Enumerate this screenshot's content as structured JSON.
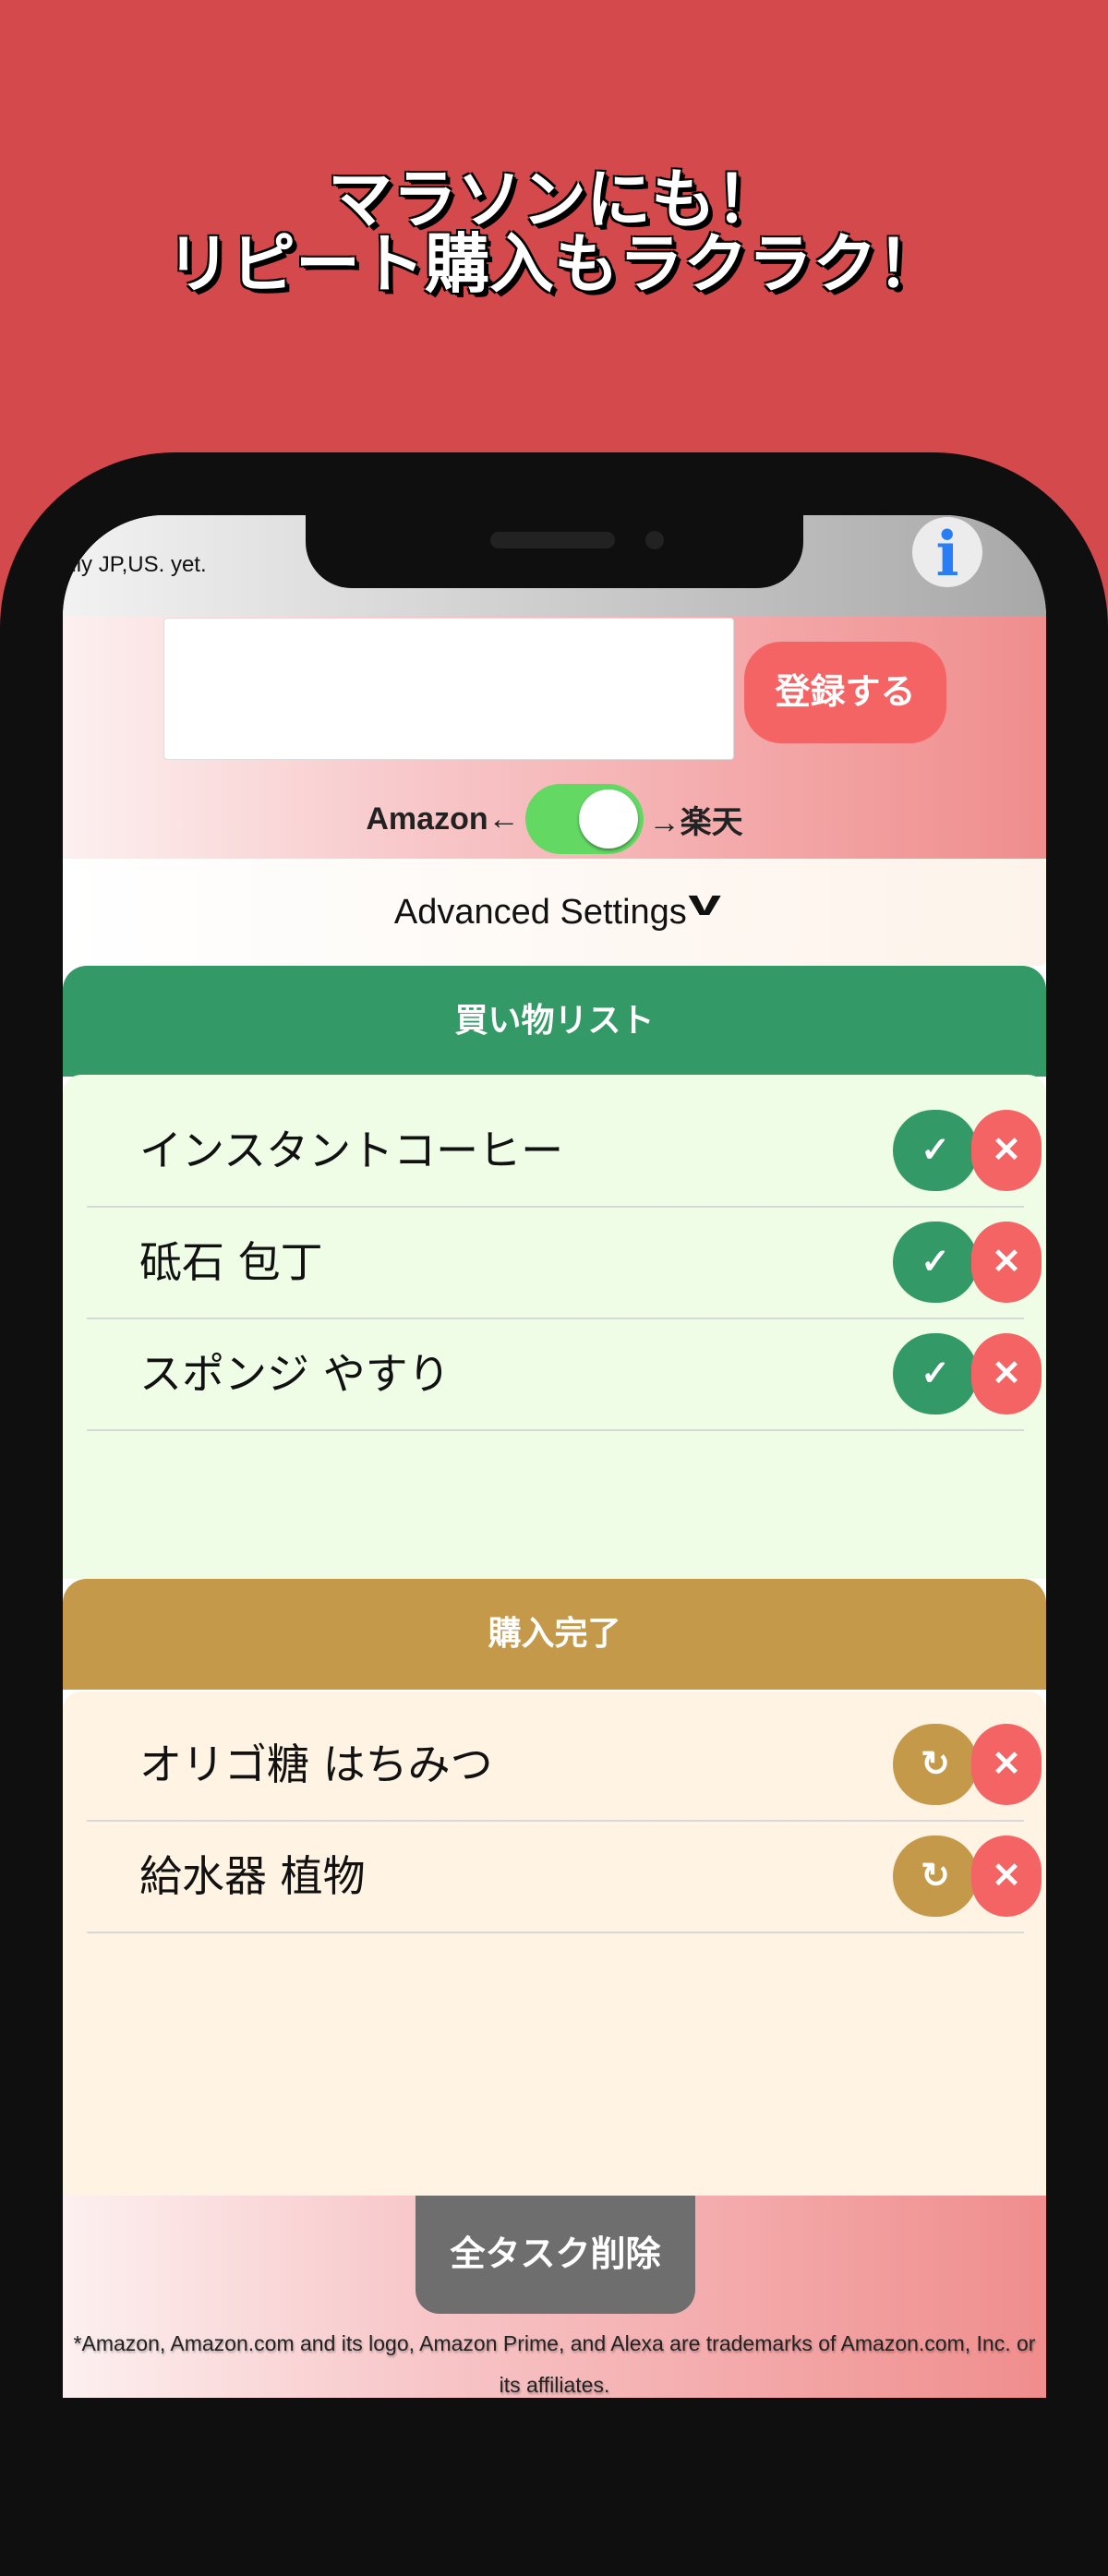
{
  "promo": {
    "line1": "マラソンにも！",
    "line2": "リピート購入もラクラク！"
  },
  "header": {
    "note": "only JP,US. yet.",
    "info_icon": "info-icon"
  },
  "form": {
    "input_value": "",
    "register_label": "登録する"
  },
  "store_toggle": {
    "left_label": "Amazon←",
    "right_label": "→楽天",
    "state": "on",
    "on_color": "#63d863"
  },
  "advanced": {
    "label": "Advanced Settings",
    "icon": "chevron-down-icon"
  },
  "shopping": {
    "title": "買い物リスト",
    "color": "#339966",
    "items": [
      {
        "label": "インスタントコーヒー"
      },
      {
        "label": "砥石 包丁"
      },
      {
        "label": "スポンジ やすり"
      }
    ]
  },
  "done": {
    "title": "購入完了",
    "color": "#c49a4a",
    "items": [
      {
        "label": "オリゴ糖 はちみつ"
      },
      {
        "label": "給水器 植物"
      }
    ]
  },
  "icons": {
    "check": "✓",
    "undo": "↻",
    "delete": "✕"
  },
  "footer": {
    "delete_all_label": "全タスク削除",
    "trademark": "*Amazon, Amazon.com and its logo, Amazon Prime, and Alexa are trademarks of Amazon.com, Inc. or its affiliates."
  }
}
